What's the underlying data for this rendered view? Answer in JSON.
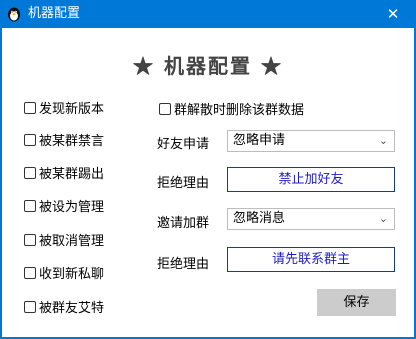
{
  "window": {
    "title": "机器配置",
    "close_glyph": "✕"
  },
  "heading": "★ 机器配置 ★",
  "left_options": [
    {
      "label": "发现新版本",
      "checked": false
    },
    {
      "label": "被某群禁言",
      "checked": false
    },
    {
      "label": "被某群踢出",
      "checked": false
    },
    {
      "label": "被设为管理",
      "checked": false
    },
    {
      "label": "被取消管理",
      "checked": false
    },
    {
      "label": "收到新私聊",
      "checked": false
    },
    {
      "label": "被群友艾特",
      "checked": false
    }
  ],
  "dissolve_option": {
    "label": "群解散时删除该群数据",
    "checked": false
  },
  "friend_request": {
    "label": "好友申请",
    "value": "忽略申请"
  },
  "friend_reject": {
    "label": "拒绝理由",
    "value": "禁止加好友"
  },
  "group_invite": {
    "label": "邀请加群",
    "value": "忽略消息"
  },
  "group_reject": {
    "label": "拒绝理由",
    "value": "请先联系群主"
  },
  "save_label": "保存"
}
